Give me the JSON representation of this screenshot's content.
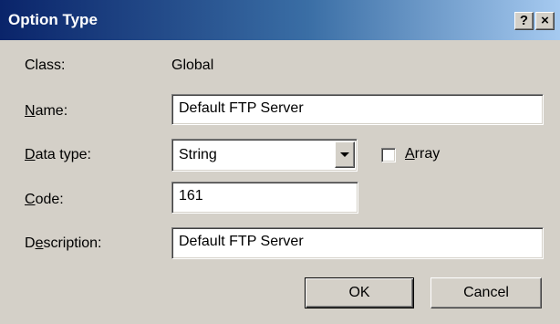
{
  "window": {
    "title": "Option Type",
    "help_label": "?",
    "close_label": "×"
  },
  "form": {
    "class_label": "Class:",
    "class_value": "Global",
    "name_label_pre": "",
    "name_label_ul": "N",
    "name_label_post": "ame:",
    "name_value": "Default FTP Server",
    "datatype_label_pre": "",
    "datatype_label_ul": "D",
    "datatype_label_post": "ata type:",
    "datatype_value": "String",
    "array_label_pre": "",
    "array_label_ul": "A",
    "array_label_post": "rray",
    "array_checked": false,
    "code_label_pre": "",
    "code_label_ul": "C",
    "code_label_post": "ode:",
    "code_value": "161",
    "description_label_pre": "D",
    "description_label_ul": "e",
    "description_label_post": "scription:",
    "description_value": "Default FTP Server"
  },
  "buttons": {
    "ok_label": "OK",
    "cancel_label": "Cancel"
  }
}
